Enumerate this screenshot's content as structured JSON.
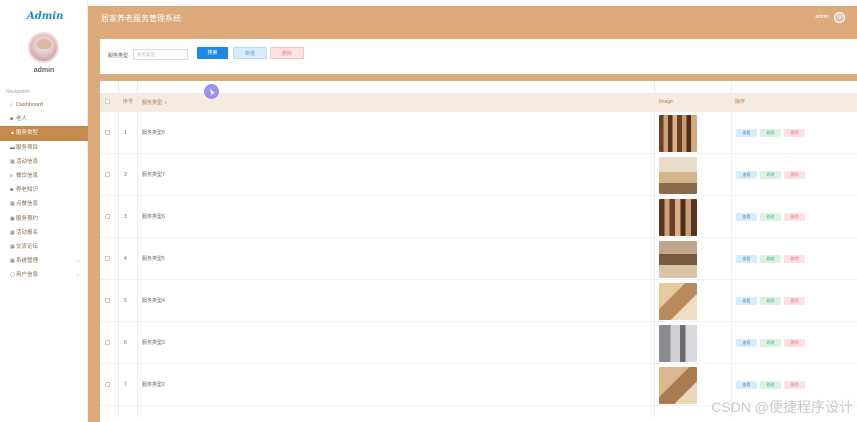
{
  "sidebar": {
    "logo": "Admin",
    "user": "admin",
    "nav_title": "Navigation",
    "items": [
      {
        "label": "Dashboard",
        "icon": "⌂",
        "icon_name": "home-icon"
      },
      {
        "label": "老人",
        "icon": "■",
        "icon_name": "person-icon"
      },
      {
        "label": "服务类型",
        "icon": "▲",
        "icon_name": "user-icon",
        "active": true
      },
      {
        "label": "服务项目",
        "icon": "▬",
        "icon_name": "list-icon"
      },
      {
        "label": "活动信息",
        "icon": "▦",
        "icon_name": "grid-icon"
      },
      {
        "label": "餐饮信息",
        "icon": "≡",
        "icon_name": "menu-icon"
      },
      {
        "label": "养老知识",
        "icon": "■",
        "icon_name": "book-icon"
      },
      {
        "label": "点餐信息",
        "icon": "▦",
        "icon_name": "grid-icon"
      },
      {
        "label": "服务预约",
        "icon": "▣",
        "icon_name": "calendar-icon"
      },
      {
        "label": "活动报名",
        "icon": "▦",
        "icon_name": "grid-icon"
      },
      {
        "label": "交流论坛",
        "icon": "▦",
        "icon_name": "grid-icon"
      },
      {
        "label": "系统管理",
        "icon": "▦",
        "icon_name": "grid-icon",
        "chevron": "⌄"
      },
      {
        "label": "用户信息",
        "icon": "▢",
        "icon_name": "profile-icon",
        "chevron": "⌄"
      }
    ]
  },
  "header": {
    "title": "居家养老服务管理系统",
    "user": "admin"
  },
  "search": {
    "label": "服务类型",
    "placeholder": "服务类型",
    "search_btn": "搜索",
    "add_btn": "新增",
    "delete_btn": "删除"
  },
  "table": {
    "columns": [
      "序号",
      "服务类型",
      "Image",
      "操作"
    ],
    "actions": {
      "view": "查看",
      "edit": "修改",
      "delete": "删除"
    },
    "rows": [
      {
        "index": "1",
        "type": "服务类型8"
      },
      {
        "index": "2",
        "type": "服务类型7"
      },
      {
        "index": "3",
        "type": "服务类型6"
      },
      {
        "index": "4",
        "type": "服务类型5"
      },
      {
        "index": "5",
        "type": "服务类型4"
      },
      {
        "index": "6",
        "type": "服务类型3"
      },
      {
        "index": "7",
        "type": "服务类型2"
      }
    ]
  },
  "watermark": "CSDN @便捷程序设计",
  "colors": {
    "header": "#dcaa7b",
    "active": "#c58a4e",
    "accent": "#1e88e5"
  }
}
